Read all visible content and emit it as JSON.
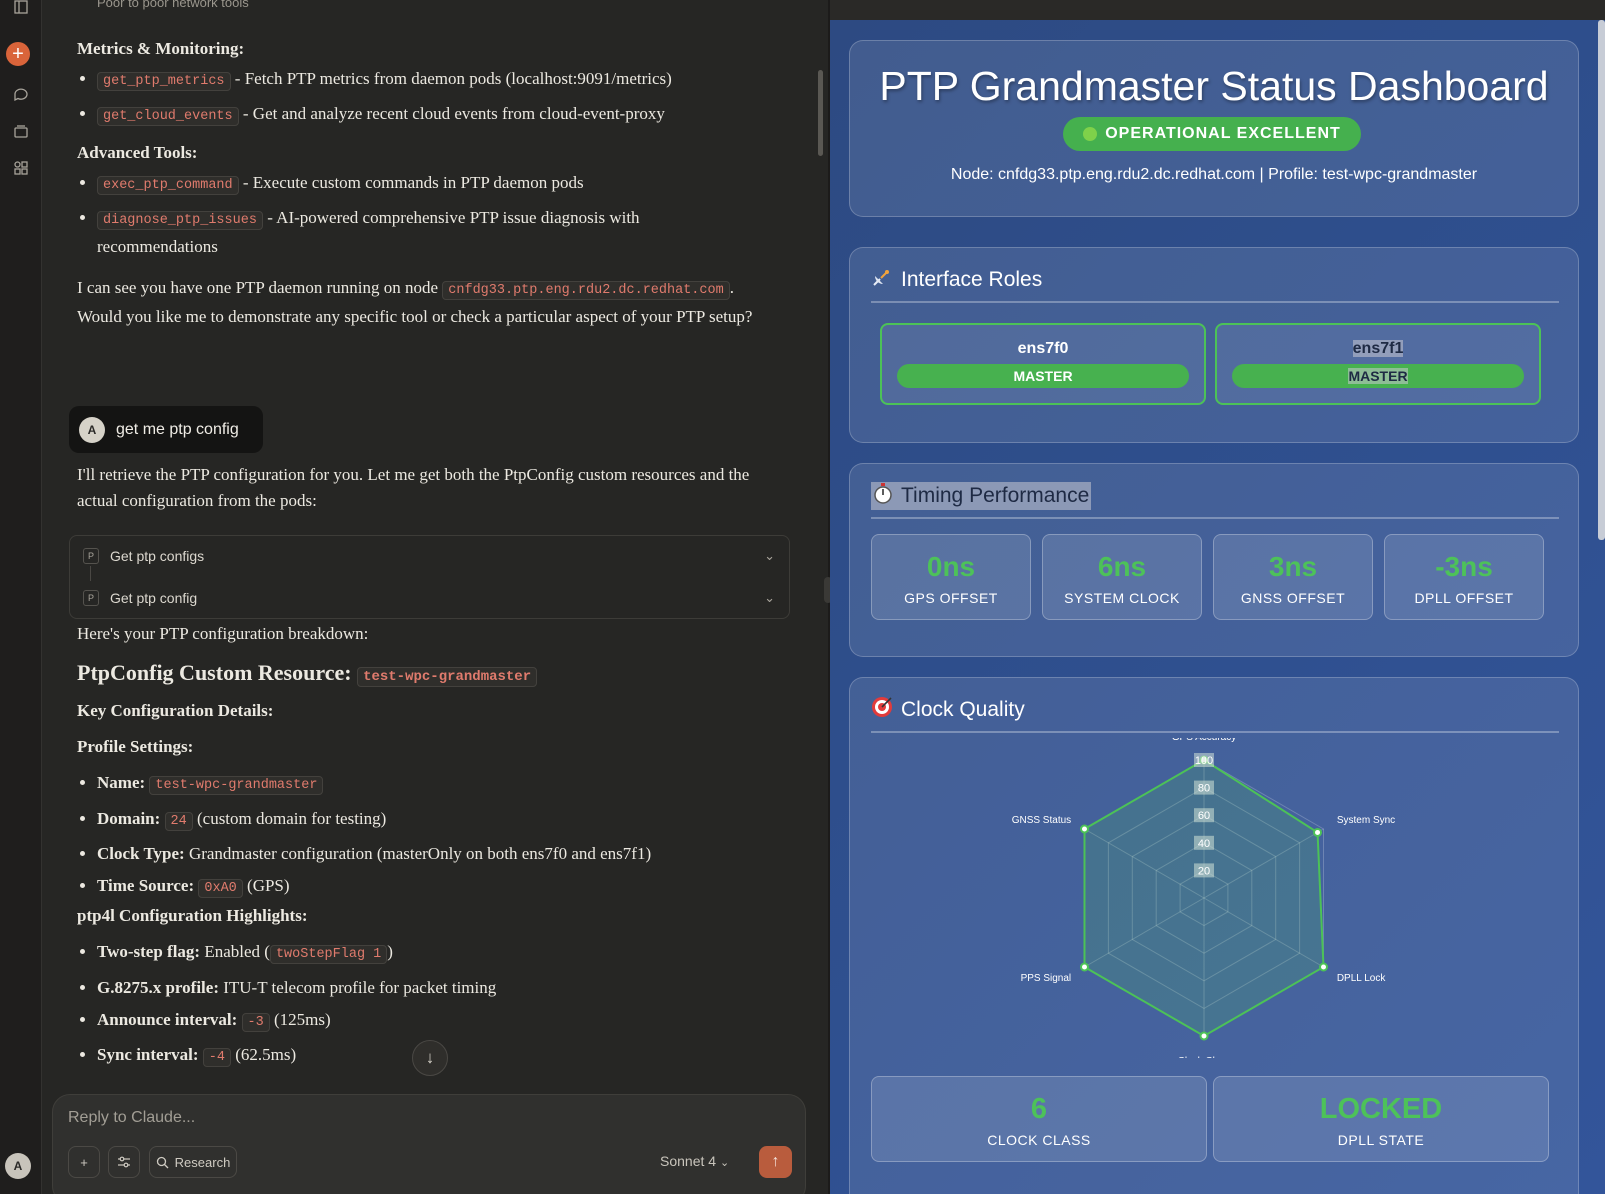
{
  "chat": {
    "cut_text": "Poor to poor network tools",
    "metrics_heading": "Metrics & Monitoring:",
    "metrics_items": [
      {
        "code": "get_ptp_metrics",
        "text": " - Fetch PTP metrics from daemon pods (localhost:9091/metrics)"
      },
      {
        "code": "get_cloud_events",
        "text": " - Get and analyze recent cloud events from cloud-event-proxy"
      }
    ],
    "advanced_heading": "Advanced Tools:",
    "advanced_items": [
      {
        "code": "exec_ptp_command",
        "text": " - Execute custom commands in PTP daemon pods"
      },
      {
        "code": "diagnose_ptp_issues",
        "text": " - AI-powered comprehensive PTP issue diagnosis with recommendations"
      }
    ],
    "para_before": "I can see you have one PTP daemon running on node ",
    "para_code": "cnfdg33.ptp.eng.rdu2.dc.redhat.com",
    "para_after": ". Would you like me to demonstrate any specific tool or check a particular aspect of your PTP setup?",
    "user_avatar": "A",
    "user_message": "get me ptp config",
    "reply_intro": "I'll retrieve the PTP configuration for you. Let me get both the PtpConfig custom resources and the actual configuration from the pods:",
    "tool_badge": "P",
    "tool_calls": [
      "Get ptp configs",
      "Get ptp config"
    ],
    "breakdown": "Here's your PTP configuration breakdown:",
    "h2_text": "PtpConfig Custom Resource: ",
    "h2_code": "test-wpc-grandmaster",
    "key_details": "Key Configuration Details:",
    "profile_heading": "Profile Settings:",
    "profile_items": [
      {
        "label": "Name:",
        "code": "test-wpc-grandmaster",
        "text": ""
      },
      {
        "label": "Domain:",
        "code": "24",
        "text": " (custom domain for testing)"
      },
      {
        "label": "Clock Type:",
        "code": "",
        "text": " Grandmaster configuration (masterOnly on both ens7f0 and ens7f1)"
      },
      {
        "label": "Time Source:",
        "code": "0xA0",
        "text": " (GPS)"
      }
    ],
    "ptp4l_heading": "ptp4l Configuration Highlights:",
    "ptp4l_items": [
      {
        "label": "Two-step flag:",
        "pre": " Enabled (",
        "code": "twoStepFlag 1",
        "text": ")"
      },
      {
        "label": "G.8275.x profile:",
        "pre": " ITU-T telecom profile for packet timing",
        "code": "",
        "text": ""
      },
      {
        "label": "Announce interval:",
        "pre": " ",
        "code": "-3",
        "text": " (125ms)"
      },
      {
        "label": "Sync interval:",
        "pre": " ",
        "code": "-4",
        "text": " (62.5ms)"
      }
    ],
    "composer_placeholder": "Reply to Claude...",
    "research_label": "Research",
    "model_label": "Sonnet 4",
    "rail_avatar": "A"
  },
  "dashboard": {
    "title": "PTP Grandmaster Status Dashboard",
    "status": "OPERATIONAL EXCELLENT",
    "node_line": "Node: cnfdg33.ptp.eng.rdu2.dc.redhat.com | Profile: test-wpc-grandmaster",
    "interface_title": "Interface Roles",
    "interfaces": [
      {
        "name": "ens7f0",
        "role": "MASTER"
      },
      {
        "name": "ens7f1",
        "role": "MASTER"
      }
    ],
    "timing_title": "Timing Performance",
    "timing": [
      {
        "value": "0ns",
        "label": "GPS OFFSET"
      },
      {
        "value": "6ns",
        "label": "SYSTEM CLOCK"
      },
      {
        "value": "3ns",
        "label": "GNSS OFFSET"
      },
      {
        "value": "-3ns",
        "label": "DPLL OFFSET"
      }
    ],
    "quality_title": "Clock Quality",
    "clock_class": {
      "value": "6",
      "label": "CLOCK CLASS"
    },
    "dpll_state": {
      "value": "LOCKED",
      "label": "DPLL STATE"
    },
    "colors": {
      "accent_green": "#4dc259",
      "bg_blue": "#2f5090"
    }
  },
  "chart_data": {
    "type": "radar",
    "categories": [
      "GPS Accuracy",
      "System Sync",
      "DPLL Lock",
      "Clock Class",
      "PPS Signal",
      "GNSS Status"
    ],
    "values": [
      100,
      95,
      100,
      100,
      100,
      100
    ],
    "ticks": [
      "20",
      "40",
      "60",
      "80",
      "100"
    ],
    "rmax": 100,
    "color": "#4cc257"
  }
}
